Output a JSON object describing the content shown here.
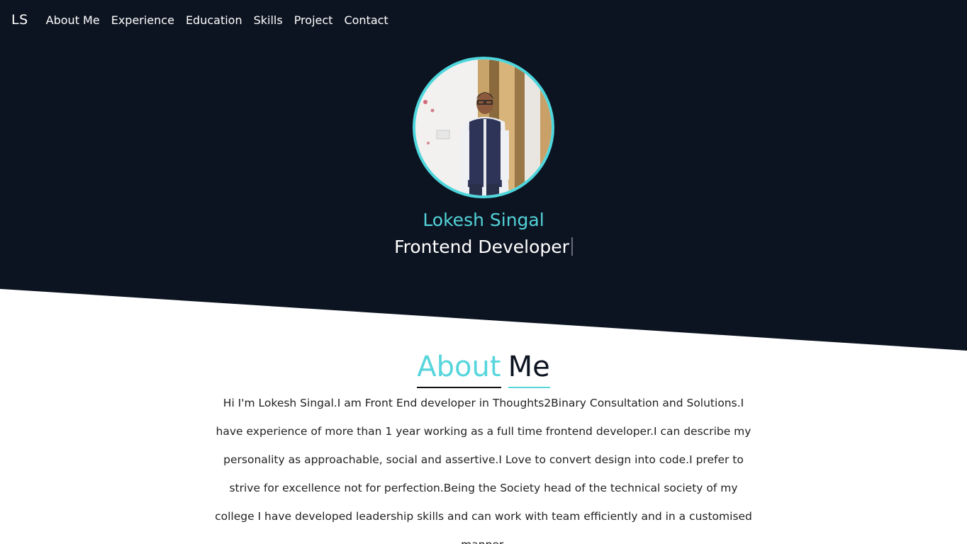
{
  "nav": {
    "brand": "LS",
    "links": [
      "About Me",
      "Experience",
      "Education",
      "Skills",
      "Project",
      "Contact"
    ]
  },
  "hero": {
    "name": "Lokesh Singal",
    "role": "Frontend Developer"
  },
  "about": {
    "title_part1": "About",
    "title_part2": "Me",
    "text": "Hi I'm Lokesh Singal.I am Front End developer in Thoughts2Binary Consultation and Solutions.I have experience of more than 1 year working as a full time frontend developer.I can describe my personality as approachable, social and assertive.I Love to convert design into code.I prefer to strive for excellence not for perfection.Being the Society head of the technical society of my college I have developed leadership skills and can work with team efficiently and in a customised manner."
  },
  "colors": {
    "hero_bg": "#0d1421",
    "accent": "#52d3d9",
    "text": "#222222"
  }
}
